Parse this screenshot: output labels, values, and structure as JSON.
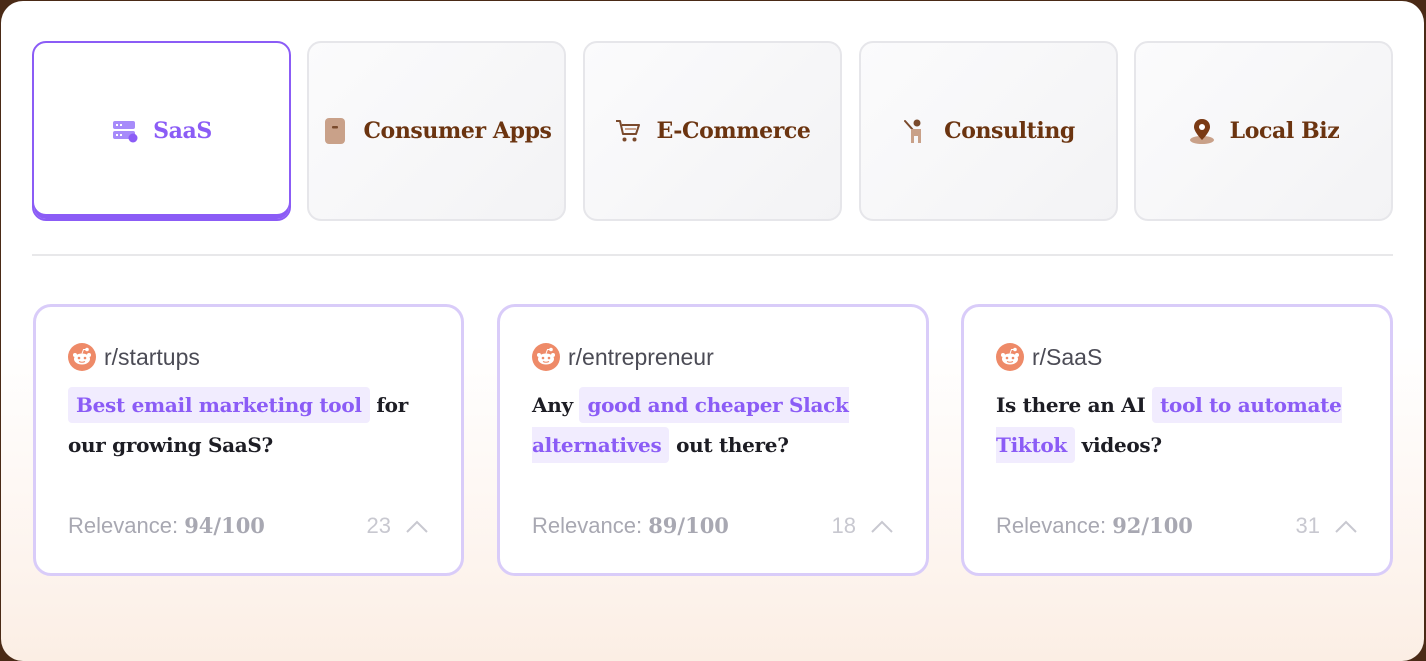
{
  "tabs": [
    {
      "label": "SaaS",
      "icon": "server-icon",
      "active": true
    },
    {
      "label": "Consumer Apps",
      "icon": "phone-icon",
      "active": false
    },
    {
      "label": "E-Commerce",
      "icon": "cart-icon",
      "active": false
    },
    {
      "label": "Consulting",
      "icon": "presenter-icon",
      "active": false
    },
    {
      "label": "Local Biz",
      "icon": "map-pin-icon",
      "active": false
    }
  ],
  "colors": {
    "accent": "#8b5cf6",
    "tab_text": "#6b3410",
    "highlight_bg": "#f1ecfe",
    "card_border": "#d9ccf9",
    "reddit_icon": "#ee8a68"
  },
  "posts": [
    {
      "subreddit": "r/startups",
      "pre": "",
      "highlight": "Best email marketing tool",
      "post": " for our growing SaaS?",
      "relevance_label": "Relevance: ",
      "relevance_score": "94/100",
      "upvotes": "23"
    },
    {
      "subreddit": "r/entrepreneur",
      "pre": "Any ",
      "highlight": "good and cheaper Slack alternatives",
      "post": " out there?",
      "relevance_label": "Relevance: ",
      "relevance_score": "89/100",
      "upvotes": "18"
    },
    {
      "subreddit": "r/SaaS",
      "pre": "Is there an AI ",
      "highlight": "tool to automate Tiktok",
      "post": " videos?",
      "relevance_label": "Relevance: ",
      "relevance_score": "92/100",
      "upvotes": "31"
    }
  ]
}
